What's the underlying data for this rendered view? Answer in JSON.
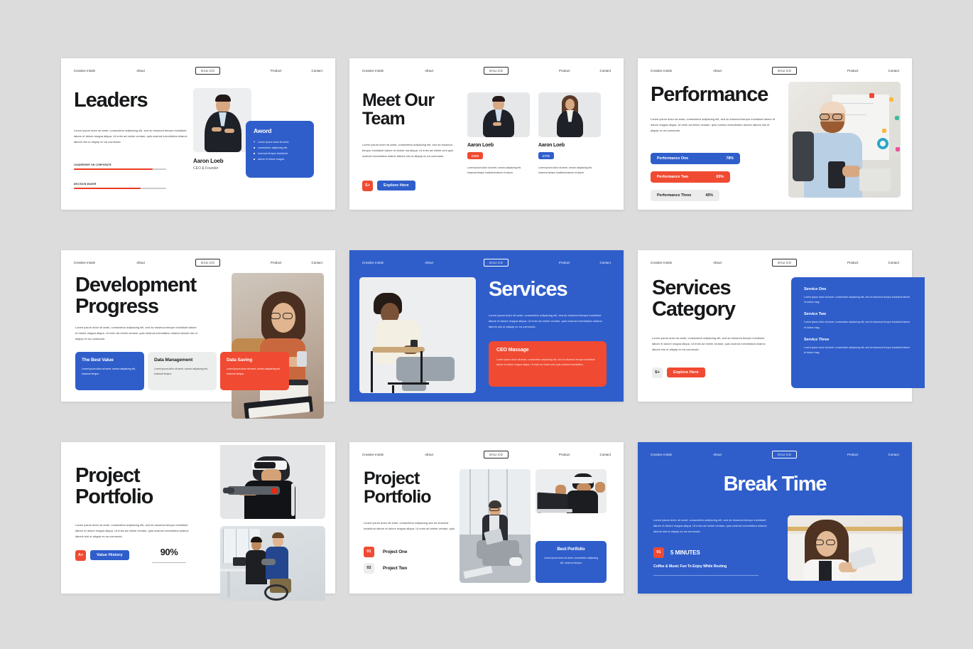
{
  "nav": {
    "creative": "Creative Inside",
    "about": "About",
    "logo": "GALI.CO",
    "product": "Product",
    "contact": "Contact"
  },
  "lorem": {
    "long": "Lorem ipsum dolor sit amet, consectetur adipiscing elit, sed do eiusmod tempor incididunt  labore et dolore magna aliqua. Ut enim ad minim veniam, quis nostrud exercitation ullamci laboris nisi ut aliquip ex ea commodo.",
    "medium": "Lorem ipsum dolor sit amet, consectetur adipiscing elit, sed do eiusmod tempor incididunt  labore et dolore ma aliqua. Ut enim ad minim veni quis nostrud exercitation ullamc laboris nisi ut aliquip ex ea commodo.",
    "short": "Lorem ipsum dolor sit amet, consec adipiscing elit, eiusmod tempor incididunt  labore et dolore",
    "tiny": "Lorem ipsum dolor sit amet, consec adipiscing elit,  eiusmod tempor.",
    "card": "Lorem ipsum dolor sit amet, consectetur adipiscing elit, sed do eiusmod tempor incididunt  labore et dolore magna aliqua. Ut enim ad minim veni quis nostrud exercitation.",
    "svc": "Lorem ipsum dolor sit amet, consectetur adipiscing elit, sed do eiusmod tempor incididunt  labore et dolore mag.",
    "s8": "Lorem ipsum dolor sit amet, consectetur adipiscing sed do eiusmod  incididunt  labore et dolore magna aliqua. Ut enim ad minim veniam, quis .",
    "s8card": "Lorem ipsum dolor sit amet, consectetur adipiscing elit, eiusmod tempor"
  },
  "slide1": {
    "title": "Leaders",
    "bars": [
      {
        "label": "LEADERSHIP ON CORPORATE",
        "value": 85
      },
      {
        "label": "DECISION MAKER",
        "value": 72
      }
    ],
    "name": "Aaron Loeb",
    "role": "CEO & Founder",
    "award_title": "Aword",
    "award_items": [
      "Lorem ipsum dolor sit amet,",
      "consectetur adipiscing elit,",
      "eiusmod tempor incididunt",
      "labore et dolore magna"
    ]
  },
  "slide2": {
    "title": "Meet Our Team",
    "badge_s": "S+",
    "cta": "Explore Here",
    "members": [
      {
        "name": "Aaron Loeb",
        "role": "CEO",
        "role_color": "red"
      },
      {
        "name": "Aaron Loeb",
        "role": "CTO",
        "role_color": "blue"
      }
    ]
  },
  "slide3": {
    "title": "Performance",
    "bars": [
      {
        "label": "Performance One",
        "value": "78%",
        "style": "p1"
      },
      {
        "label": "Performance Two",
        "value": "65%",
        "style": "p2"
      },
      {
        "label": "Performance Three",
        "value": "45%",
        "style": "p3"
      }
    ]
  },
  "slide4": {
    "title": "Development Progress",
    "cards": [
      {
        "title": "The Best Value",
        "style": "c-blue"
      },
      {
        "title": "Data Management",
        "style": "c-gray"
      },
      {
        "title": "Data Saving",
        "style": "c-red"
      }
    ]
  },
  "slide5": {
    "title": "Services",
    "card_title": "CEO Massage"
  },
  "slide6": {
    "title": "Services Category",
    "badge_s": "S+",
    "cta": "Explore Here",
    "services": [
      {
        "title": "Service One"
      },
      {
        "title": "Service Two"
      },
      {
        "title": "Service Three"
      }
    ]
  },
  "slide7": {
    "title": "Project Portfolio",
    "badge_a": "A+",
    "cta": "Value History",
    "percent": "90%"
  },
  "slide8": {
    "title": "Project Portfolio",
    "projects": [
      {
        "num": "01",
        "label": "Project One",
        "style": "red"
      },
      {
        "num": "02",
        "label": "Project Two",
        "style": "gray"
      }
    ],
    "card_title": "Best Portfolio"
  },
  "slide9": {
    "title": "Break Time",
    "num": "01",
    "minutes": "5 MINUTES",
    "subtitle": "Coffee & Music Fun To Enjoy While Resting"
  },
  "colors": {
    "blue": "#2f5ecb",
    "red": "#f04a32",
    "gray": "#eceded",
    "bg": "#dcdcdc",
    "ink": "#17181a"
  }
}
